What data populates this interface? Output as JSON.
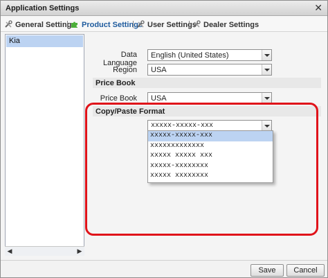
{
  "window": {
    "title": "Application Settings"
  },
  "toolbar": {
    "items": [
      {
        "label": "General Settings",
        "icon": "wrench-screwdriver-icon"
      },
      {
        "label": "Product Settings",
        "icon": "puzzle-icon"
      },
      {
        "label": "User Settings",
        "icon": "wrench-screwdriver-icon"
      },
      {
        "label": "Dealer Settings",
        "icon": "wrench-screwdriver-icon"
      }
    ],
    "separator": "|"
  },
  "sidebar": {
    "items": [
      {
        "label": "Kia"
      }
    ]
  },
  "form": {
    "data_language": {
      "label": "Data Language",
      "value": "English (United States)"
    },
    "region": {
      "label": "Region",
      "value": "USA"
    },
    "price_book_section": "Price Book",
    "price_book": {
      "label": "Price Book",
      "value": "USA"
    },
    "copy_paste_section": "Copy/Paste Format",
    "copy_paste_format": {
      "value": "xxxxx-xxxxx-xxx"
    }
  },
  "dropdown": {
    "options": [
      "xxxxx-xxxxx-xxx",
      "xxxxxxxxxxxxx",
      "xxxxx xxxxx xxx",
      "xxxxx-xxxxxxxx",
      "xxxxx xxxxxxxx"
    ],
    "selected_index": 0
  },
  "buttons": {
    "save": "Save",
    "cancel": "Cancel"
  },
  "colors": {
    "highlight": "#e0131a",
    "selection": "#bcd3f2",
    "active_tab": "#1d5a9d"
  }
}
